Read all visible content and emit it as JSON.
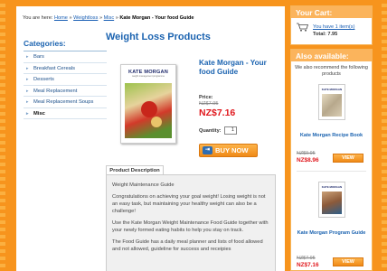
{
  "breadcrumb": {
    "prefix": "You are here:",
    "home": "Home",
    "cat": "Weightloss",
    "sub": "Misc",
    "current": "Kate Morgan - Your food Guide",
    "sep": "»"
  },
  "sidebar": {
    "title": "Categories:",
    "items": [
      {
        "label": "Bars"
      },
      {
        "label": "Breakfast Cereals"
      },
      {
        "label": "Desserts"
      },
      {
        "label": "Meal Replacement"
      },
      {
        "label": "Meal Replacement Soups"
      },
      {
        "label": "Misc"
      }
    ]
  },
  "page": {
    "title": "Weight Loss Products"
  },
  "product": {
    "brand": "KATE MORGAN",
    "cover_subtitle": "weight management programme",
    "name": "Kate Morgan - Your food Guide",
    "price_label": "Price:",
    "old_price": "NZ$7.95",
    "new_price": "NZ$7.16",
    "quantity_label": "Quantity:",
    "quantity": "1",
    "buy_label": "BUY NOW"
  },
  "tabs": {
    "description": "Product Description"
  },
  "description": {
    "p1": "Weight Maintenance Guide",
    "p2": "Congratulations on achieving your goal weight! Losing weight is not an easy task, but maintaining your healthy weight can also be a challenge!",
    "p3": "Use the Kate Morgan Weight Maintenance Food Guide together with your newly formed eating habits to help you stay on track.",
    "p4": "The Food Guide has a daily meal planner and lists of food allowed and not allowed, guideline for success and receipies"
  },
  "cart": {
    "title": "Your Cart:",
    "items_link": "You have 1 item(s)",
    "total": "Total: 7.95"
  },
  "also": {
    "title": "Also available:",
    "intro": "We also recommend the following products",
    "items": [
      {
        "name": "Kate Morgan Recipe Book",
        "brand": "KATE MORGAN",
        "old": "NZ$9.95",
        "new": "NZ$8.96",
        "view": "VIEW"
      },
      {
        "name": "Kate Morgan Program Guide",
        "brand": "KATE MORGAN",
        "old": "NZ$7.95",
        "new": "NZ$7.16",
        "view": "VIEW"
      }
    ]
  },
  "colors": {
    "background": "#f7941d",
    "link": "#1b63b0",
    "price": "#e0171c",
    "button": "#f08a17"
  }
}
